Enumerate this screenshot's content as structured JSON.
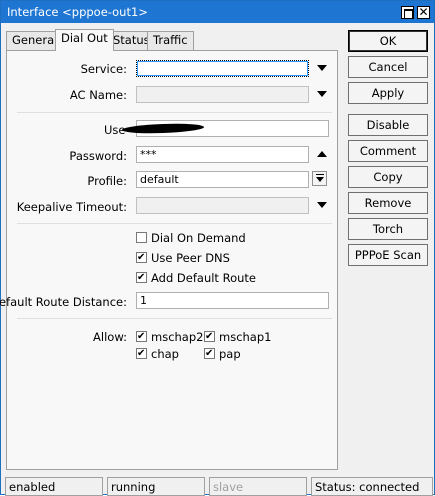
{
  "window": {
    "title": "Interface <pppoe-out1>"
  },
  "tabs": [
    {
      "label": "General"
    },
    {
      "label": "Dial Out"
    },
    {
      "label": "Status"
    },
    {
      "label": "Traffic"
    }
  ],
  "form": {
    "service_label": "Service:",
    "service_value": "",
    "ac_name_label": "AC Name:",
    "ac_name_value": "",
    "user_label": "Use",
    "user_value": "",
    "password_label": "Password:",
    "password_value": "***",
    "profile_label": "Profile:",
    "profile_value": "default",
    "keepalive_label": "Keepalive Timeout:",
    "keepalive_value": "",
    "dial_on_demand": {
      "label": "Dial On Demand",
      "checked": false
    },
    "use_peer_dns": {
      "label": "Use Peer DNS",
      "checked": true
    },
    "add_default_route": {
      "label": "Add Default Route",
      "checked": true
    },
    "default_route_distance_label": "Default Route Distance:",
    "default_route_distance_value": "1",
    "allow_label": "Allow:",
    "allow": [
      {
        "label": "mschap2",
        "checked": true
      },
      {
        "label": "mschap1",
        "checked": true
      },
      {
        "label": "chap",
        "checked": true
      },
      {
        "label": "pap",
        "checked": true
      }
    ]
  },
  "buttons": {
    "ok": "OK",
    "cancel": "Cancel",
    "apply": "Apply",
    "disable": "Disable",
    "comment": "Comment",
    "copy": "Copy",
    "remove": "Remove",
    "torch": "Torch",
    "pppoe_scan": "PPPoE Scan"
  },
  "status_bar": {
    "enabled": "enabled",
    "running": "running",
    "slave": "slave",
    "status": "Status: connected"
  },
  "colors": {
    "titlebar": "#1f76d2",
    "window_bg": "#f0f0f0",
    "panel_bg": "#f8f8f8"
  }
}
